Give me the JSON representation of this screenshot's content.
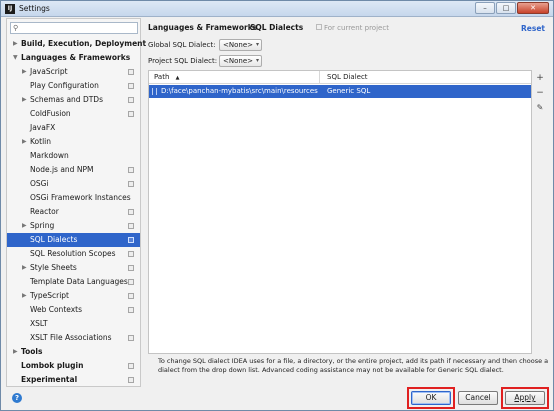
{
  "window": {
    "title": "Settings",
    "app_icon": "intellij-icon"
  },
  "search": {
    "placeholder": "",
    "icon": "search-icon"
  },
  "sidebar": {
    "items": [
      {
        "label": "Build, Execution, Deployment",
        "bold": true,
        "arrow": "collapsed",
        "copy": false
      },
      {
        "label": "Languages & Frameworks",
        "bold": true,
        "arrow": "expanded",
        "copy": false
      },
      {
        "label": "JavaScript",
        "arrow": "collapsed",
        "copy": true
      },
      {
        "label": "Play Configuration",
        "arrow": "",
        "copy": true
      },
      {
        "label": "Schemas and DTDs",
        "arrow": "collapsed",
        "copy": true
      },
      {
        "label": "ColdFusion",
        "arrow": "",
        "copy": true
      },
      {
        "label": "JavaFX",
        "arrow": "",
        "copy": false
      },
      {
        "label": "Kotlin",
        "arrow": "collapsed",
        "copy": false
      },
      {
        "label": "Markdown",
        "arrow": "",
        "copy": false
      },
      {
        "label": "Node.js and NPM",
        "arrow": "",
        "copy": true
      },
      {
        "label": "OSGi",
        "arrow": "",
        "copy": true
      },
      {
        "label": "OSGi Framework Instances",
        "arrow": "",
        "copy": false
      },
      {
        "label": "Reactor",
        "arrow": "",
        "copy": true
      },
      {
        "label": "Spring",
        "arrow": "collapsed",
        "copy": true
      },
      {
        "label": "SQL Dialects",
        "arrow": "",
        "copy": true,
        "selected": true
      },
      {
        "label": "SQL Resolution Scopes",
        "arrow": "",
        "copy": true
      },
      {
        "label": "Style Sheets",
        "arrow": "collapsed",
        "copy": true
      },
      {
        "label": "Template Data Languages",
        "arrow": "",
        "copy": true
      },
      {
        "label": "TypeScript",
        "arrow": "collapsed",
        "copy": true
      },
      {
        "label": "Web Contexts",
        "arrow": "",
        "copy": true
      },
      {
        "label": "XSLT",
        "arrow": "",
        "copy": false
      },
      {
        "label": "XSLT File Associations",
        "arrow": "",
        "copy": true
      },
      {
        "label": "Tools",
        "bold": true,
        "arrow": "collapsed",
        "copy": false
      },
      {
        "label": "Lombok plugin",
        "bold": true,
        "arrow": "",
        "copy": true
      },
      {
        "label": "Experimental",
        "bold": true,
        "arrow": "",
        "copy": true
      }
    ]
  },
  "main": {
    "breadcrumb_parent": "Languages & Frameworks",
    "breadcrumb_sep": "›",
    "breadcrumb_current": "SQL Dialects",
    "for_current_project": "For current project",
    "reset_label": "Reset",
    "global_label": "Global SQL Dialect:",
    "global_value": "<None>",
    "project_label": "Project SQL Dialect:",
    "project_value": "<None>",
    "table": {
      "col_path": "Path",
      "col_path_sort": "▲",
      "col_dialect": "SQL Dialect",
      "rows": [
        {
          "path": "D:\\face\\panchan-mybatis\\src\\main\\resources\\lib\\",
          "dialect": "Generic SQL"
        }
      ]
    },
    "toolbar": {
      "add": "+",
      "remove": "−",
      "edit": "✎"
    },
    "help_text": "To change SQL dialect IDEA uses for a file, a directory, or the entire project, add its path if necessary and then choose a dialect from the drop down list. Advanced coding assistance may not be available for Generic SQL dialect."
  },
  "buttons": {
    "ok": "OK",
    "cancel": "Cancel",
    "apply": "Apply",
    "help": "?"
  },
  "colors": {
    "selection": "#2f65ca",
    "highlight_box": "#e02020",
    "link": "#2f65ca"
  }
}
